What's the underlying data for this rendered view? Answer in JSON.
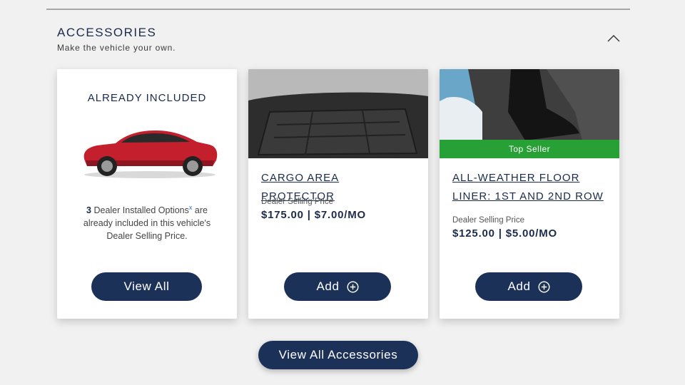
{
  "section": {
    "title": "ACCESSORIES",
    "subtitle": "Make the vehicle your own."
  },
  "cards": {
    "included": {
      "heading": "ALREADY INCLUDED",
      "count": "3",
      "text_1": " Dealer Installed Options",
      "footnote": "x",
      "text_2": " are already included in this vehicle's Dealer Selling Price.",
      "button": "View All"
    },
    "cargo": {
      "title": "CARGO AREA PROTECTOR",
      "price_label": "Dealer Selling Price",
      "price": "$175.00 | $7.00/MO",
      "button": "Add"
    },
    "floor": {
      "badge": "Top Seller",
      "title": "ALL-WEATHER FLOOR LINER: 1ST AND 2ND ROW",
      "price_label": "Dealer Selling Price",
      "price": "$125.00 | $5.00/MO",
      "button": "Add"
    }
  },
  "footer": {
    "view_all_button": "View All Accessories"
  },
  "colors": {
    "navy": "#1c3158",
    "badge_green": "#27a136",
    "background": "#f1f1f1"
  },
  "icons": {
    "collapse": "chevron-up-icon",
    "add": "plus-circle-icon"
  }
}
